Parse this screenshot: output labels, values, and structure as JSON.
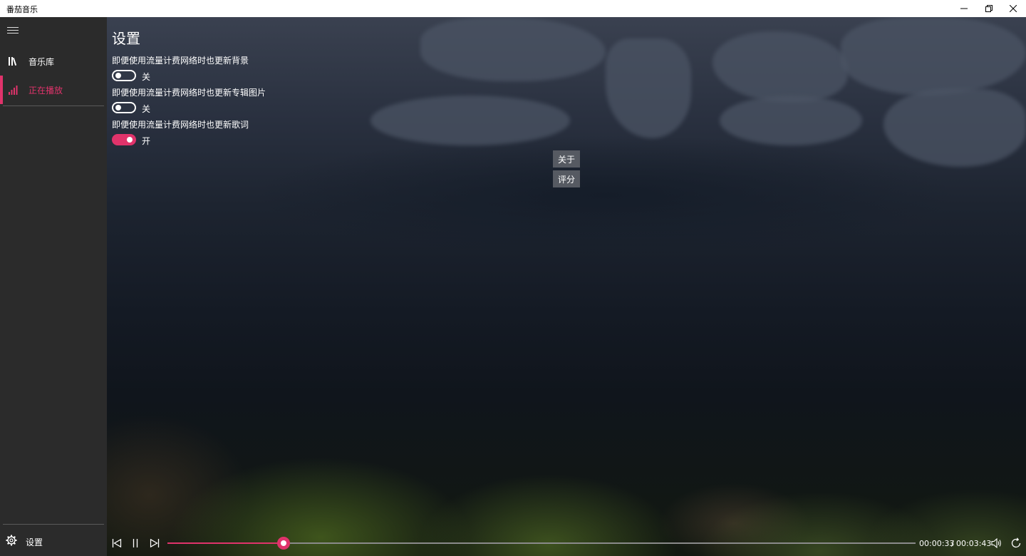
{
  "window": {
    "title": "番茄音乐"
  },
  "sidebar": {
    "items": [
      {
        "label": "音乐库",
        "icon": "library-icon",
        "active": false
      },
      {
        "label": "正在播放",
        "icon": "now-playing-icon",
        "active": true
      }
    ],
    "settings_label": "设置"
  },
  "settings": {
    "title": "设置",
    "options": [
      {
        "label": "即便使用流量计费网络时也更新背景",
        "state": "关",
        "on": false
      },
      {
        "label": "即便使用流量计费网络时也更新专辑图片",
        "state": "关",
        "on": false
      },
      {
        "label": "即便使用流量计费网络时也更新歌词",
        "state": "开",
        "on": true
      }
    ],
    "about_label": "关于",
    "rate_label": "评分"
  },
  "player": {
    "current_time": "00:00:33",
    "separator": "/",
    "total_time": "00:03:43",
    "progress": 0.155
  },
  "colors": {
    "accent": "#e0336b",
    "sidebar": "#2b2b2b"
  }
}
